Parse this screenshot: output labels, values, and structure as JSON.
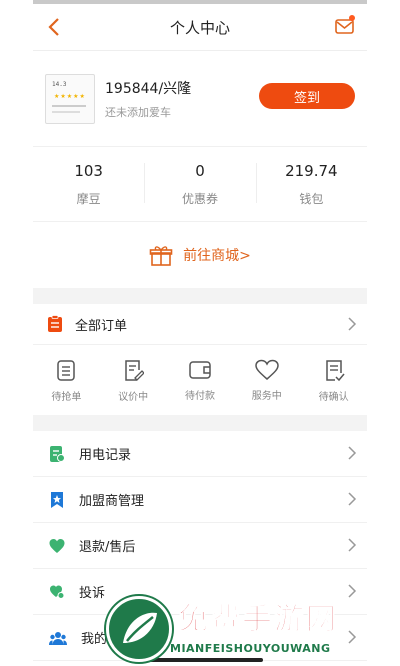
{
  "header": {
    "title": "个人中心"
  },
  "profile": {
    "name": "195844/兴隆",
    "subtitle": "还未添加爱车",
    "signin_label": "签到",
    "avatar_text": "14.3"
  },
  "stats": [
    {
      "value": "103",
      "label": "摩豆"
    },
    {
      "value": "0",
      "label": "优惠券"
    },
    {
      "value": "219.74",
      "label": "钱包"
    }
  ],
  "mall": {
    "label": "前往商城>"
  },
  "orders": {
    "header_label": "全部订单",
    "items": [
      {
        "label": "待抢单",
        "icon": "clipboard-icon"
      },
      {
        "label": "议价中",
        "icon": "edit-document-icon"
      },
      {
        "label": "待付款",
        "icon": "wallet-icon"
      },
      {
        "label": "服务中",
        "icon": "heart-icon"
      },
      {
        "label": "待确认",
        "icon": "checklist-icon"
      }
    ]
  },
  "menu": [
    {
      "label": "用电记录",
      "icon": "power-record-icon",
      "color": "#3cb371"
    },
    {
      "label": "加盟商管理",
      "icon": "star-badge-icon",
      "color": "#1e78d7"
    },
    {
      "label": "退款/售后",
      "icon": "heart-icon",
      "color": "#3cb371"
    },
    {
      "label": "投诉",
      "icon": "complaint-icon",
      "color": "#3cb371"
    },
    {
      "label": "我的",
      "icon": "team-icon",
      "color": "#1e78d7"
    }
  ],
  "watermark": {
    "title": "免费手游网",
    "subtitle": "MIANFEISHOUYOUWANG"
  },
  "colors": {
    "accent": "#ee4b10",
    "mall": "#e0651e"
  }
}
